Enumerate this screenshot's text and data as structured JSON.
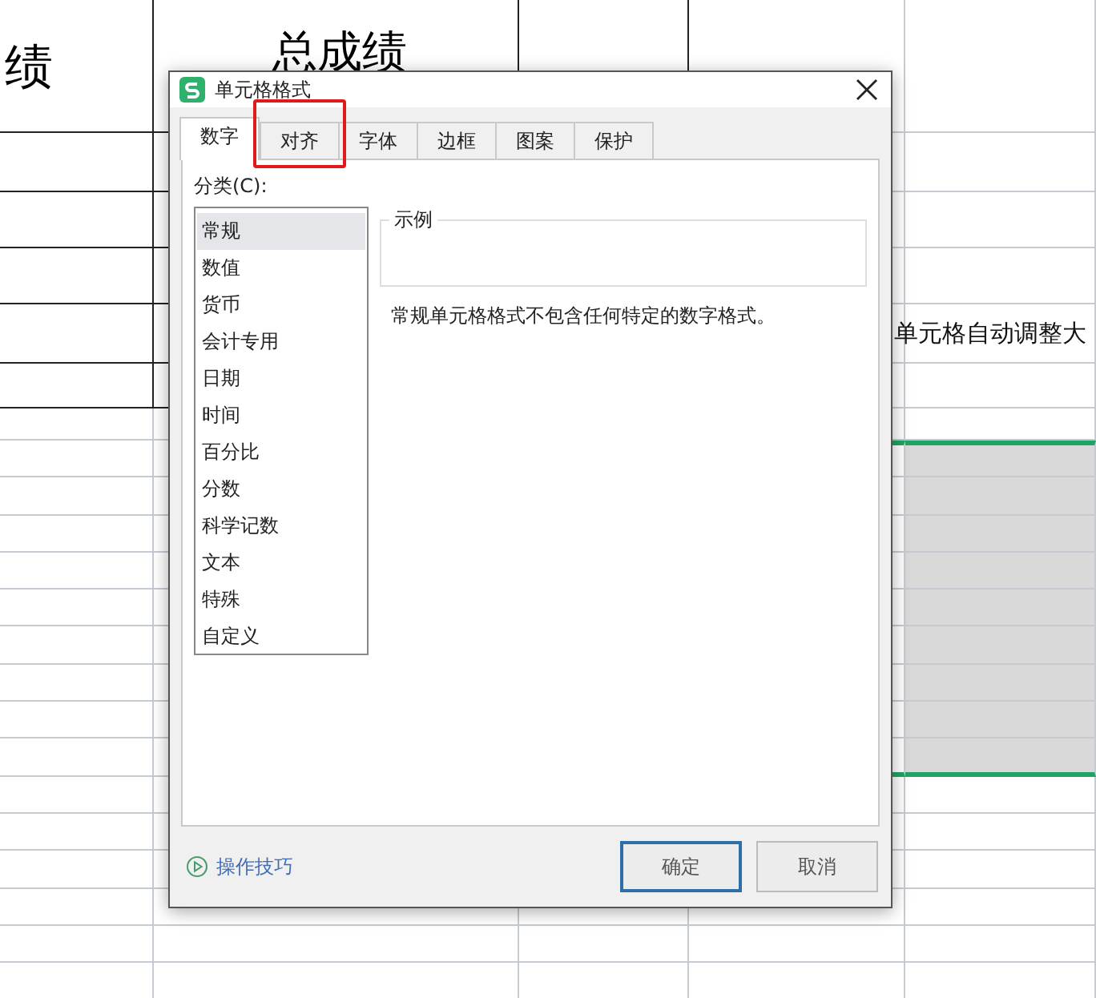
{
  "sheet": {
    "header_cells": [
      "绩",
      "总成绩"
    ],
    "overflow_text": "单元格自动调整大"
  },
  "dialog": {
    "title": "单元格格式",
    "tabs": [
      {
        "label": "数字",
        "selected": true,
        "highlighted": false
      },
      {
        "label": "对齐",
        "selected": false,
        "highlighted": true
      },
      {
        "label": "字体",
        "selected": false,
        "highlighted": false
      },
      {
        "label": "边框",
        "selected": false,
        "highlighted": false
      },
      {
        "label": "图案",
        "selected": false,
        "highlighted": false
      },
      {
        "label": "保护",
        "selected": false,
        "highlighted": false
      }
    ],
    "category_label": "分类(C):",
    "categories": [
      {
        "label": "常规",
        "selected": true
      },
      {
        "label": "数值",
        "selected": false
      },
      {
        "label": "货币",
        "selected": false
      },
      {
        "label": "会计专用",
        "selected": false
      },
      {
        "label": "日期",
        "selected": false
      },
      {
        "label": "时间",
        "selected": false
      },
      {
        "label": "百分比",
        "selected": false
      },
      {
        "label": "分数",
        "selected": false
      },
      {
        "label": "科学记数",
        "selected": false
      },
      {
        "label": "文本",
        "selected": false
      },
      {
        "label": "特殊",
        "selected": false
      },
      {
        "label": "自定义",
        "selected": false
      }
    ],
    "sample_label": "示例",
    "description": "常规单元格格式不包含任何特定的数字格式。",
    "tips_link": "操作技巧",
    "buttons": [
      {
        "label": "确定",
        "kind": "primary"
      },
      {
        "label": "取消",
        "kind": "secondary"
      }
    ]
  }
}
